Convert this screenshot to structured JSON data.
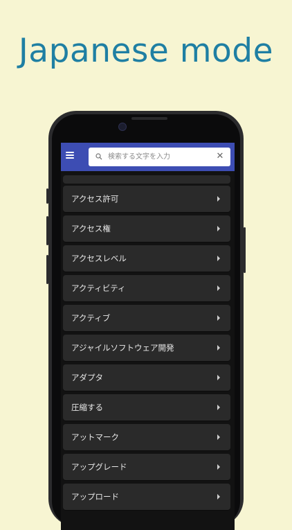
{
  "promo": {
    "headline": "Japanese mode"
  },
  "search": {
    "placeholder": "検索する文字を入力",
    "value": ""
  },
  "list": {
    "items": [
      {
        "label": "アクセス許可"
      },
      {
        "label": "アクセス権"
      },
      {
        "label": "アクセスレベル"
      },
      {
        "label": "アクティビティ"
      },
      {
        "label": "アクティブ"
      },
      {
        "label": "アジャイルソフトウェア開発"
      },
      {
        "label": "アダプタ"
      },
      {
        "label": "圧縮する"
      },
      {
        "label": "アットマーク"
      },
      {
        "label": "アップグレード"
      },
      {
        "label": "アップロード"
      }
    ]
  },
  "colors": {
    "background": "#f7f5d2",
    "headline": "#1f7fa3",
    "appbar": "#3d4db3",
    "list_item": "#2a2a2a"
  },
  "icons": [
    "menu-icon",
    "search-icon",
    "clear-icon",
    "chevron-right-icon"
  ]
}
